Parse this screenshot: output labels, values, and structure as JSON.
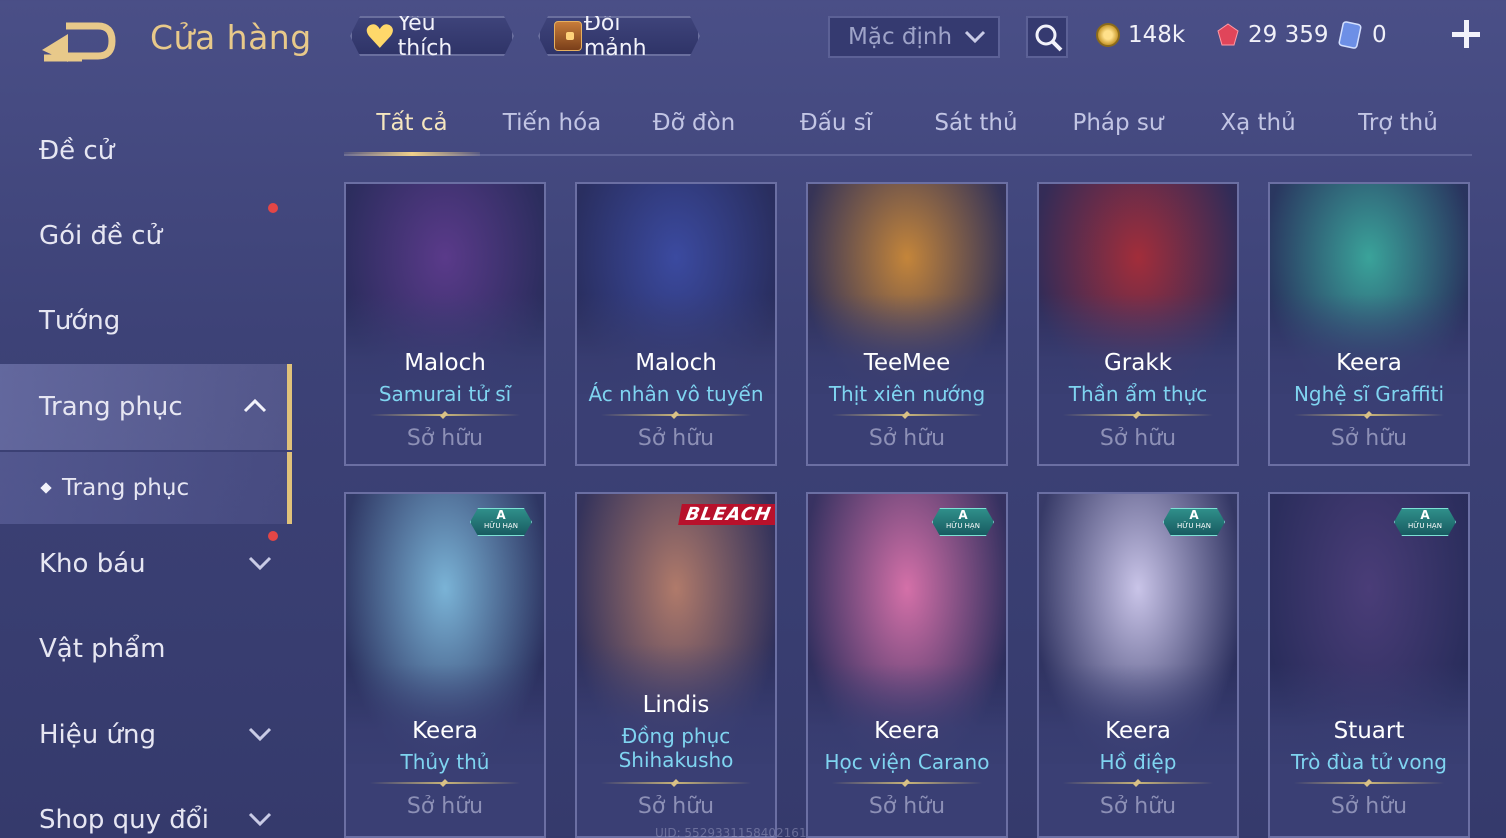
{
  "header": {
    "title": "Cửa hàng",
    "favorites_label": "Yêu thích",
    "exchange_label": "Đổi mảnh",
    "sort_selected": "Mặc định",
    "currencies": {
      "gold": "148k",
      "gems": "29 359",
      "vouchers": "0"
    }
  },
  "sidebar": {
    "items": [
      {
        "label": "Đề cử"
      },
      {
        "label": "Gói đề cử"
      },
      {
        "label": "Tướng"
      },
      {
        "label": "Trang phục"
      },
      {
        "label": "Trang phục"
      },
      {
        "label": "Kho báu"
      },
      {
        "label": "Vật phẩm"
      },
      {
        "label": "Hiệu ứng"
      },
      {
        "label": "Shop quy đổi"
      }
    ]
  },
  "tabs": [
    {
      "label": "Tất cả"
    },
    {
      "label": "Tiến hóa"
    },
    {
      "label": "Đỡ đòn"
    },
    {
      "label": "Đấu sĩ"
    },
    {
      "label": "Sát thủ"
    },
    {
      "label": "Pháp sư"
    },
    {
      "label": "Xạ thủ"
    },
    {
      "label": "Trợ thủ"
    }
  ],
  "cards": [
    {
      "hero": "Maloch",
      "skin": "Samurai tử sĩ",
      "status": "Sở hữu",
      "accent": "#5a3a8a"
    },
    {
      "hero": "Maloch",
      "skin": "Ác nhân vô tuyến",
      "status": "Sở hữu",
      "accent": "#3b4aa0"
    },
    {
      "hero": "TeeMee",
      "skin": "Thịt xiên nướng",
      "status": "Sở hữu",
      "accent": "#c4853a"
    },
    {
      "hero": "Grakk",
      "skin": "Thần ẩm thực",
      "status": "Sở hữu",
      "accent": "#a22d3a"
    },
    {
      "hero": "Keera",
      "skin": "Nghệ sĩ Graffiti",
      "status": "Sở hữu",
      "accent": "#3aa39a"
    },
    {
      "hero": "Keera",
      "skin": "Thủy thủ",
      "status": "Sở hữu",
      "accent": "#7ab3d6",
      "badge": "A",
      "badge_sub": "HỮU HẠN"
    },
    {
      "hero": "Lindis",
      "skin": "Đồng phục Shihakusho",
      "status": "Sở hữu",
      "accent": "#b07a6a",
      "logo": "BLEACH"
    },
    {
      "hero": "Keera",
      "skin": "Học viện Carano",
      "status": "Sở hữu",
      "accent": "#d470a8",
      "badge": "A",
      "badge_sub": "HỮU HẠN"
    },
    {
      "hero": "Keera",
      "skin": "Hồ điệp",
      "status": "Sở hữu",
      "accent": "#c9c4e8",
      "badge": "A",
      "badge_sub": "HỮU HẠN"
    },
    {
      "hero": "Stuart",
      "skin": "Trò đùa tử vong",
      "status": "Sở hữu",
      "accent": "#4a3d78",
      "badge": "A",
      "badge_sub": "HỮU HẠN"
    }
  ],
  "footer": {
    "uid": "UID: 5529331158402161"
  }
}
